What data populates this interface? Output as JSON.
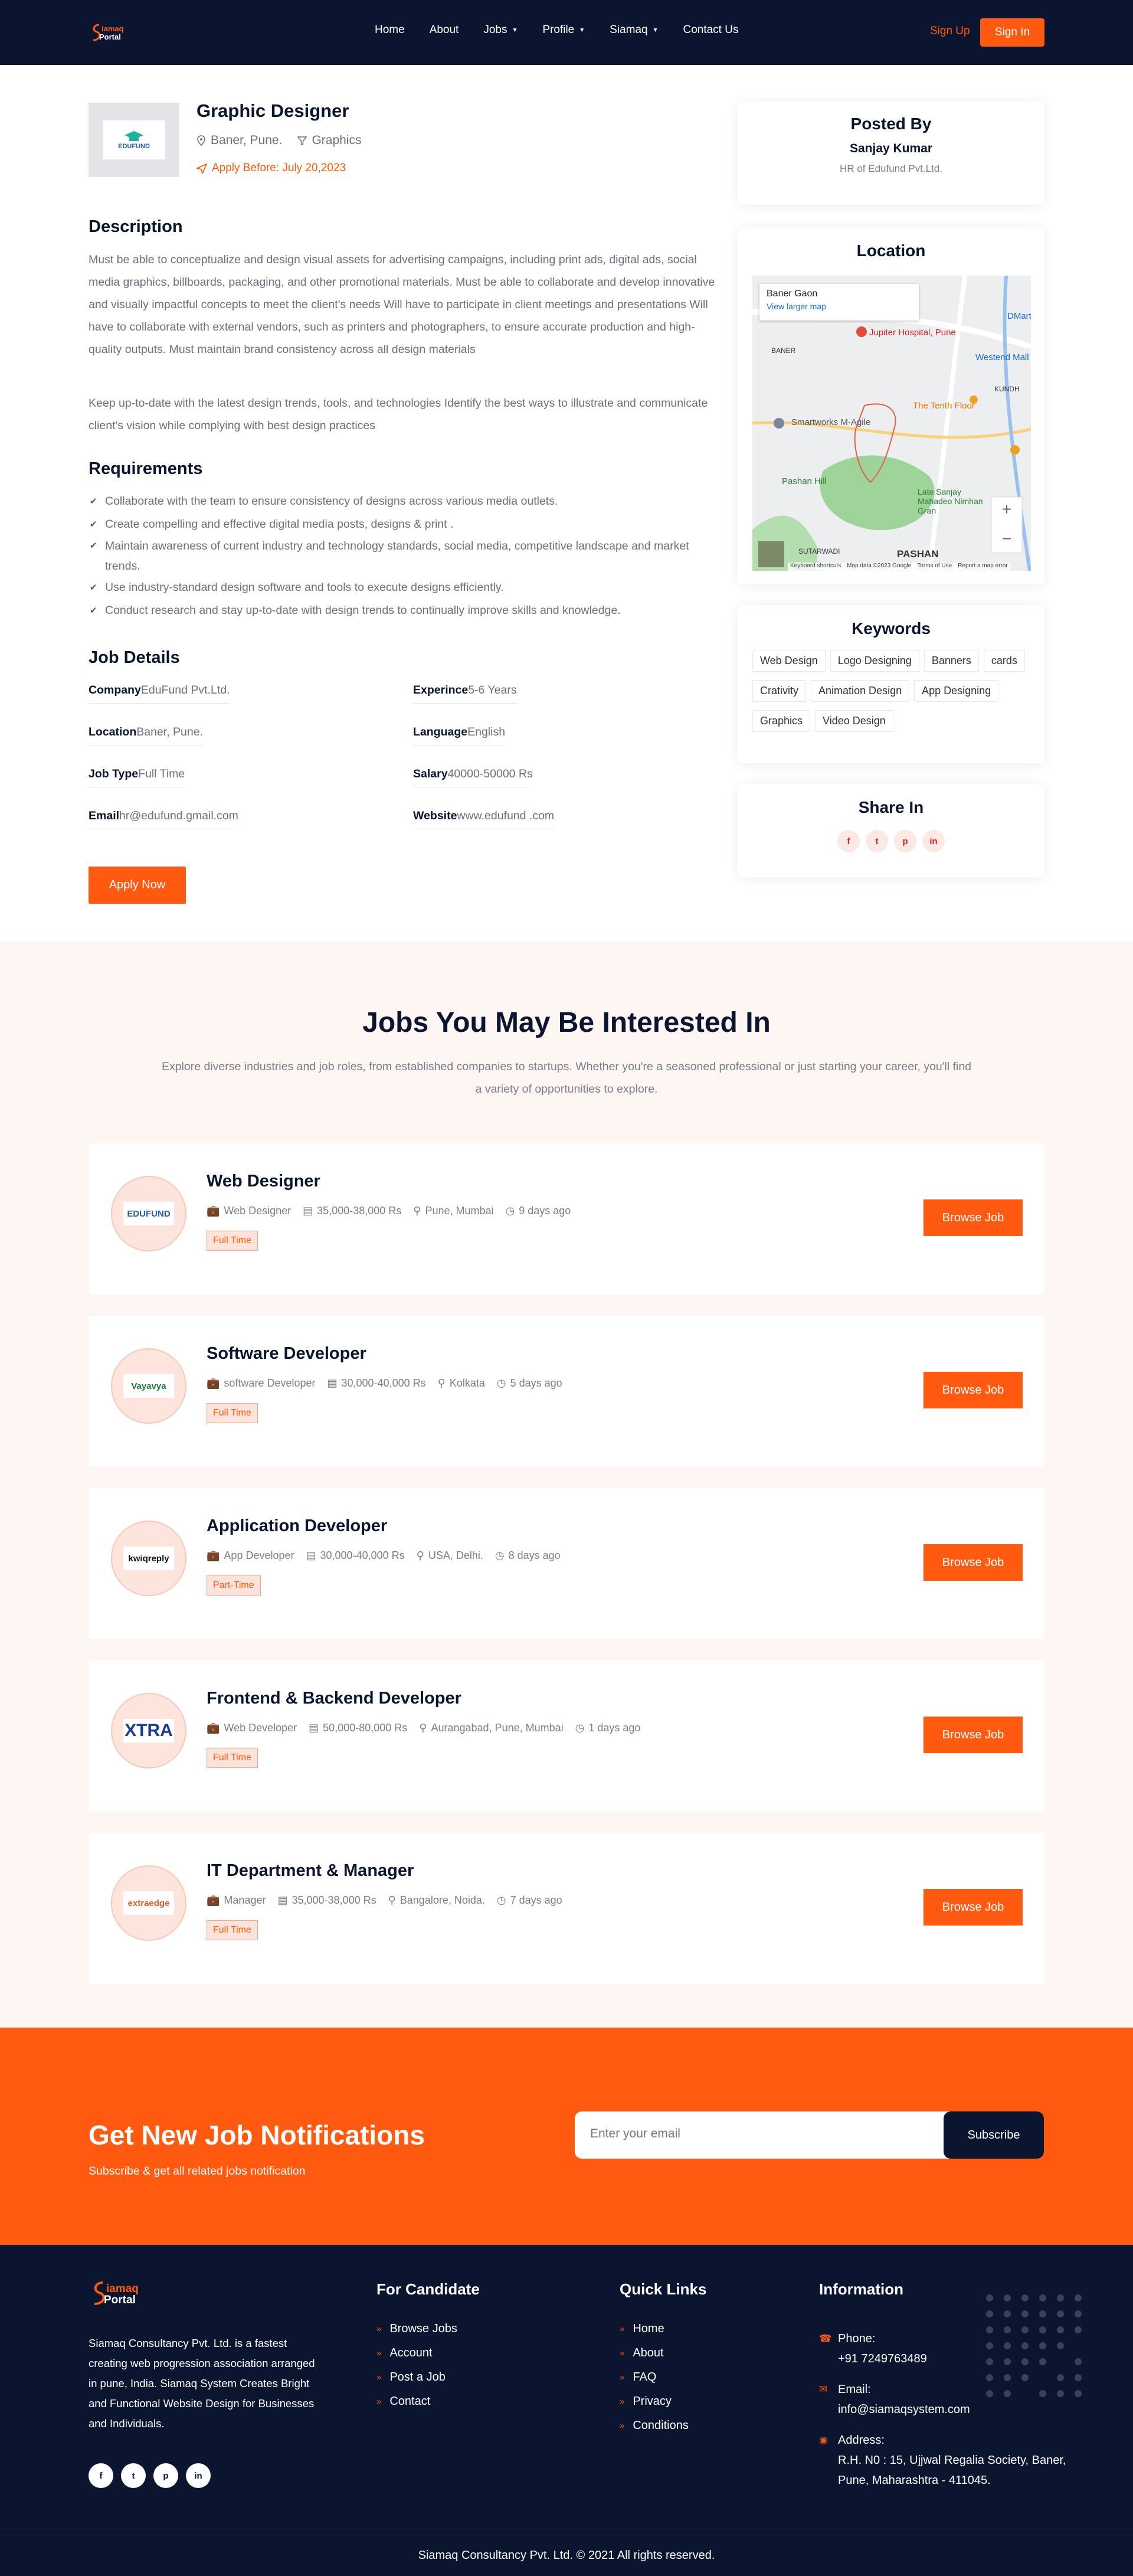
{
  "header": {
    "nav": [
      {
        "label": "Home",
        "dropdown": false
      },
      {
        "label": "About",
        "dropdown": false
      },
      {
        "label": "Jobs",
        "dropdown": true
      },
      {
        "label": "Profile",
        "dropdown": true
      },
      {
        "label": "Siamaq",
        "dropdown": true
      },
      {
        "label": "Contact Us",
        "dropdown": false
      }
    ],
    "sign_up": "Sign Up",
    "sign_in": "Sign In",
    "logo_text": "Siamaq Portal"
  },
  "job": {
    "logo_text": "EDUFUND",
    "title": "Graphic Designer",
    "location": "Baner, Pune.",
    "category": "Graphics",
    "apply_before": "Apply Before: July 20,2023",
    "description_heading": "Description",
    "description_1": "Must be able to conceptualize and design visual assets for advertising campaigns, including print ads, digital ads, social media graphics, billboards, packaging, and other promotional materials. Must be able to collaborate and develop innovative and visually impactful concepts to meet the client's needs Will have to participate in client meetings and presentations Will have to collaborate with external vendors, such as printers and photographers, to ensure accurate production and high-quality outputs. Must maintain brand consistency across all design materials",
    "description_2": "Keep up-to-date with the latest design trends, tools, and technologies Identify the best ways to illustrate and communicate client's vision while complying with best design practices",
    "requirements_heading": "Requirements",
    "requirements": [
      "Collaborate with the team to ensure consistency of designs across various media outlets.",
      "Create compelling and effective digital media posts, designs & print .",
      "Maintain awareness of current industry and technology standards, social media, competitive landscape and market trends.",
      "Use industry-standard design software and tools to execute designs efficiently.",
      "Conduct research and stay up-to-date with design trends to continually improve skills and knowledge."
    ],
    "details_heading": "Job Details",
    "details": [
      {
        "label": "Company",
        "value": "EduFund Pvt.Ltd."
      },
      {
        "label": "Experince",
        "value": "5-6 Years"
      },
      {
        "label": "Location",
        "value": "Baner, Pune."
      },
      {
        "label": "Language",
        "value": "English"
      },
      {
        "label": "Job Type",
        "value": "Full Time"
      },
      {
        "label": "Salary",
        "value": "40000-50000 Rs"
      },
      {
        "label": "Email",
        "value": "hr@edufund.gmail.com"
      },
      {
        "label": "Website",
        "value": "www.edufund .com"
      }
    ],
    "apply_button": "Apply Now"
  },
  "sidebar": {
    "posted_by_heading": "Posted By",
    "poster_name": "Sanjay Kumar",
    "poster_role": "HR of Edufund Pvt.Ltd.",
    "location_heading": "Location",
    "map": {
      "place": "Baner Gaon",
      "larger_map": "View larger map",
      "labels": [
        "Jupiter Hospital, Pune",
        "Westend Mall",
        "The Tenth Floor",
        "Smartworks M-Agile",
        "Pashan Hill",
        "Late Sanjay Mahadeo Nimhan Gran",
        "PASHAN",
        "SUTARWADI",
        "BANER",
        "KUNDH",
        "DMart"
      ],
      "attribution": "Map data ©2023 Google",
      "terms": "Terms of Use",
      "report": "Report a map error",
      "keyboard": "Keyboard shortcuts"
    },
    "keywords_heading": "Keywords",
    "keywords": [
      "Web Design",
      "Logo Designing",
      "Banners",
      "cards",
      "Crativity",
      "Animation Design",
      "App Designing",
      "Graphics",
      "Video Design"
    ],
    "share_heading": "Share In",
    "share_icons": [
      "facebook-icon",
      "twitter-icon",
      "pinterest-icon",
      "linkedin-icon"
    ]
  },
  "interested": {
    "heading": "Jobs You May Be Interested In",
    "intro": "Explore diverse industries and job roles, from established companies to startups. Whether you're a seasoned professional or just starting your career, you'll find a variety of opportunities to explore.",
    "jobs": [
      {
        "title": "Web Designer",
        "role": "Web Designer",
        "salary": "35,000-38,000 Rs",
        "location": "Pune, Mumbai",
        "posted": "9 days ago",
        "type": "Full Time",
        "logo": "EDUFUND",
        "button": "Browse Job"
      },
      {
        "title": "Software Developer",
        "role": "software Developer",
        "salary": "30,000-40,000 Rs",
        "location": "Kolkata",
        "posted": "5 days ago",
        "type": "Full Time",
        "logo": "Vayavya",
        "button": "Browse Job"
      },
      {
        "title": "Application Developer",
        "role": "App Developer",
        "salary": "30,000-40,000 Rs",
        "location": "USA, Delhi.",
        "posted": "8 days ago",
        "type": "Part-Time",
        "logo": "kwiqreply",
        "button": "Browse Job"
      },
      {
        "title": "Frontend & Backend Developer",
        "role": "Web Developer",
        "salary": "50,000-80,000 Rs",
        "location": "Aurangabad, Pune, Mumbai",
        "posted": "1 days ago",
        "type": "Full Time",
        "logo": "XTRA",
        "button": "Browse Job"
      },
      {
        "title": "IT Department & Manager",
        "role": "Manager",
        "salary": "35,000-38,000 Rs",
        "location": "Bangalore, Noida.",
        "posted": "7 days ago",
        "type": "Full Time",
        "logo": "extraedge",
        "button": "Browse Job"
      }
    ]
  },
  "newsletter": {
    "heading": "Get New Job Notifications",
    "sub": "Subscribe & get all related jobs notification",
    "placeholder": "Enter your email",
    "button": "Subscribe"
  },
  "footer": {
    "about": "Siamaq Consultancy Pvt. Ltd. is a fastest creating web progression association arranged in pune, India. Siamaq System Creates Bright and Functional Website Design for Businesses and Individuals.",
    "candidate_heading": "For Candidate",
    "candidate_links": [
      "Browse Jobs",
      "Account",
      "Post a Job",
      "Contact"
    ],
    "quick_heading": "Quick Links",
    "quick_links": [
      "Home",
      "About",
      "FAQ",
      "Privacy",
      "Conditions"
    ],
    "info_heading": "Information",
    "phone_label": "Phone:",
    "phone": "+91 7249763489",
    "email_label": "Email:",
    "email": "info@siamaqsystem.com",
    "address_label": "Address:",
    "address": "R.H. N0 : 15, Ujjwal Regalia Society, Baner, Pune, Maharashtra - 411045.",
    "copyright": "Siamaq Consultancy Pvt. Ltd. © 2021 All rights reserved.",
    "social_icons": [
      "facebook-icon",
      "twitter-icon",
      "pinterest-icon",
      "linkedin-icon"
    ]
  },
  "colors": {
    "accent": "#ff5a0f",
    "navy": "#0b1530"
  }
}
